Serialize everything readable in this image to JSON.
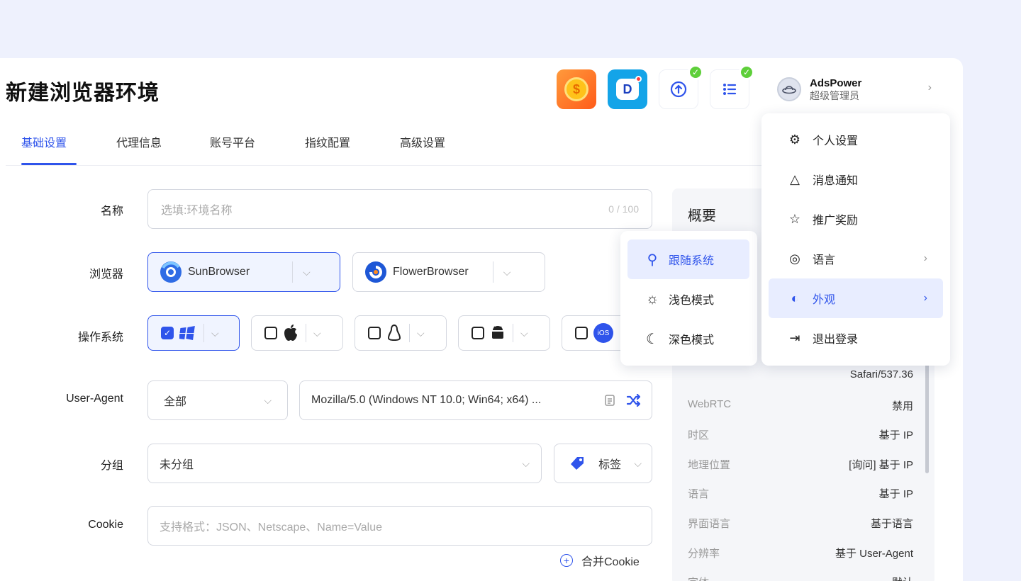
{
  "page_title": "新建浏览器环境",
  "header": {
    "coin_icon_glyph": "$",
    "blue_icon_glyph": "D",
    "user": {
      "name": "AdsPower",
      "role": "超级管理员"
    }
  },
  "tabs": [
    {
      "label": "基础设置",
      "active": true
    },
    {
      "label": "代理信息"
    },
    {
      "label": "账号平台"
    },
    {
      "label": "指纹配置"
    },
    {
      "label": "高级设置"
    }
  ],
  "form": {
    "name": {
      "label": "名称",
      "placeholder": "选填:环境名称",
      "counter": "0 / 100"
    },
    "browser": {
      "label": "浏览器",
      "options": [
        "SunBrowser",
        "FlowerBrowser"
      ],
      "selected": "SunBrowser"
    },
    "os": {
      "label": "操作系统",
      "ios_text": "iOS"
    },
    "user_agent": {
      "label": "User-Agent",
      "filter": "全部",
      "value": "Mozilla/5.0 (Windows NT 10.0; Win64; x64) ..."
    },
    "group": {
      "label": "分组",
      "value": "未分组",
      "tag_label": "标签"
    },
    "cookie": {
      "label": "Cookie",
      "placeholder": "支持格式：JSON、Netscape、Name=Value",
      "merge_label": "合并Cookie"
    }
  },
  "summary": {
    "title": "概要",
    "ua_tail": "Safari/537.36",
    "rows": [
      {
        "key": "WebRTC",
        "value": "禁用"
      },
      {
        "key": "时区",
        "value": "基于 IP"
      },
      {
        "key": "地理位置",
        "value": "[询问] 基于 IP"
      },
      {
        "key": "语言",
        "value": "基于 IP"
      },
      {
        "key": "界面语言",
        "value": "基于语言"
      },
      {
        "key": "分辨率",
        "value": "基于 User-Agent"
      },
      {
        "key": "字体",
        "value": "默认"
      }
    ]
  },
  "user_menu": [
    {
      "label": "个人设置",
      "icon": "gear-icon"
    },
    {
      "label": "消息通知",
      "icon": "bell-icon"
    },
    {
      "label": "推广奖励",
      "icon": "star-icon"
    },
    {
      "label": "语言",
      "icon": "globe-icon",
      "has_submenu": true
    },
    {
      "label": "外观",
      "icon": "appearance-icon",
      "has_submenu": true,
      "active": true
    },
    {
      "label": "退出登录",
      "icon": "logout-icon"
    }
  ],
  "appearance_menu": [
    {
      "label": "跟随系统",
      "icon": "follow-system-icon",
      "active": true
    },
    {
      "label": "浅色模式",
      "icon": "sun-icon"
    },
    {
      "label": "深色模式",
      "icon": "moon-icon"
    }
  ],
  "colors": {
    "accent": "#2f54eb",
    "background": "#eef1fd",
    "success": "#5ecf3a"
  }
}
